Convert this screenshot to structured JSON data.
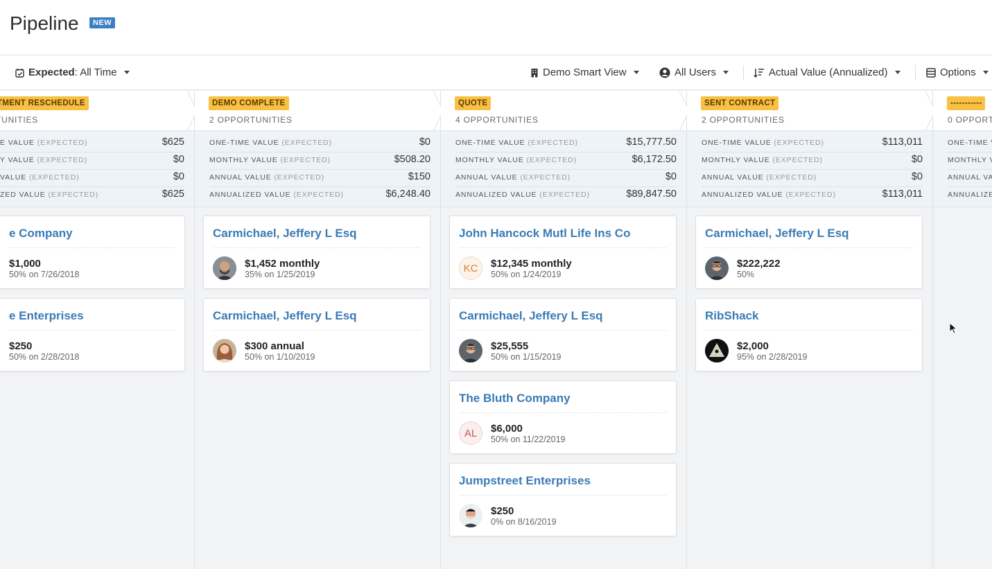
{
  "header": {
    "title": "Pipeline",
    "badge": "NEW"
  },
  "toolbar": {
    "expected_label": "Expected",
    "expected_value": ": All Time",
    "smart_view": "Demo Smart View",
    "users": "All Users",
    "sort": "Actual Value (Annualized)",
    "options": "Options"
  },
  "summary_labels": {
    "one_time": "ONE-TIME VALUE",
    "monthly": "MONTHLY VALUE",
    "annual": "ANNUAL VALUE",
    "annualized": "ANNUALIZED VALUE",
    "expected": "(EXPECTED)"
  },
  "partial_labels": {
    "col0": {
      "one_time": "E VALUE",
      "monthly": "Y VALUE",
      "annual": "VALUE",
      "annualized": "ZED VALUE"
    },
    "col4": {
      "one_time": "ONE-TIME V",
      "monthly": "MONTHLY V",
      "annual": "ANNUAL VA",
      "annualized": "ANNUALIZE"
    }
  },
  "columns": [
    {
      "stage": "TMENT RESCHEDULE",
      "count": "TUNITIES",
      "values": {
        "one_time": "$625",
        "monthly": "$0",
        "annual": "$0",
        "annualized": "$625"
      },
      "cards": [
        {
          "title": "e Company",
          "amount": "$1,000",
          "meta": "50% on 7/26/2018"
        },
        {
          "title": "e Enterprises",
          "amount": "$250",
          "meta": "50% on 2/28/2018"
        }
      ]
    },
    {
      "stage": "DEMO COMPLETE",
      "count": "2 OPPORTUNITIES",
      "values": {
        "one_time": "$0",
        "monthly": "$508.20",
        "annual": "$150",
        "annualized": "$6,248.40"
      },
      "cards": [
        {
          "title": "Carmichael, Jeffery L Esq",
          "amount": "$1,452 monthly",
          "meta": "35% on 1/25/2019",
          "avatar": "photo-man-beard"
        },
        {
          "title": "Carmichael, Jeffery L Esq",
          "amount": "$300 annual",
          "meta": "50% on 1/10/2019",
          "avatar": "photo-woman"
        }
      ]
    },
    {
      "stage": "QUOTE",
      "count": "4 OPPORTUNITIES",
      "values": {
        "one_time": "$15,777.50",
        "monthly": "$6,172.50",
        "annual": "$0",
        "annualized": "$89,847.50"
      },
      "cards": [
        {
          "title": "John Hancock Mutl Life Ins Co",
          "amount": "$12,345 monthly",
          "meta": "50% on 1/24/2019",
          "initials": "KC"
        },
        {
          "title": "Carmichael, Jeffery L Esq",
          "amount": "$25,555",
          "meta": "50% on 1/15/2019",
          "avatar": "photo-man-glasses"
        },
        {
          "title": "The Bluth Company",
          "amount": "$6,000",
          "meta": "50% on 11/22/2019",
          "initials": "AL"
        },
        {
          "title": "Jumpstreet Enterprises",
          "amount": "$250",
          "meta": "0% on 8/16/2019",
          "avatar": "photo-man-smile"
        }
      ]
    },
    {
      "stage": "SENT CONTRACT",
      "count": "2 OPPORTUNITIES",
      "values": {
        "one_time": "$113,011",
        "monthly": "$0",
        "annual": "$0",
        "annualized": "$113,011"
      },
      "cards": [
        {
          "title": "Carmichael, Jeffery L Esq",
          "amount": "$222,222",
          "meta": "50%",
          "avatar": "photo-man-glasses"
        },
        {
          "title": "RibShack",
          "amount": "$2,000",
          "meta": "95% on 2/28/2019",
          "avatar": "pyramid-logo"
        }
      ]
    },
    {
      "stage": "-----------",
      "count": "0 OPPORT"
    }
  ],
  "colors": {
    "accent": "#3a7bb5",
    "stage_badge": "#f8c144",
    "new_badge": "#3d7fc1"
  }
}
